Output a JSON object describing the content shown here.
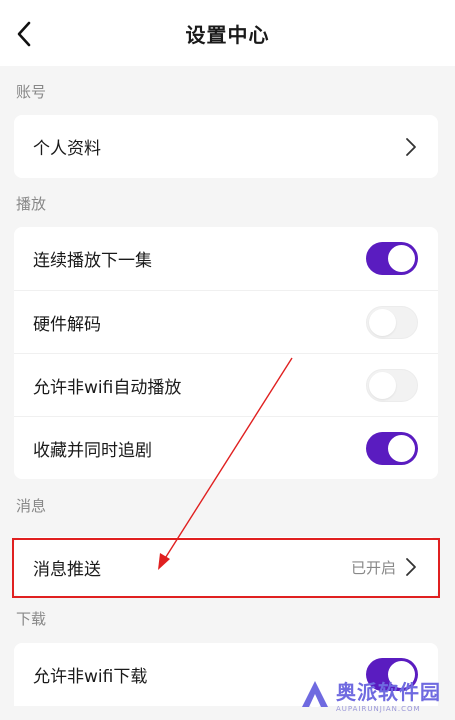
{
  "header": {
    "title": "设置中心"
  },
  "sections": {
    "account": {
      "label": "账号",
      "items": [
        {
          "label": "个人资料"
        }
      ]
    },
    "playback": {
      "label": "播放",
      "items": [
        {
          "label": "连续播放下一集",
          "toggle": "on"
        },
        {
          "label": "硬件解码",
          "toggle": "off"
        },
        {
          "label": "允许非wifi自动播放",
          "toggle": "off"
        },
        {
          "label": "收藏并同时追剧",
          "toggle": "on"
        }
      ]
    },
    "messages": {
      "label": "消息",
      "items": [
        {
          "label": "消息推送",
          "value": "已开启"
        }
      ]
    },
    "download": {
      "label": "下载",
      "items": [
        {
          "label": "允许非wifi下载",
          "toggle": "on"
        }
      ]
    }
  },
  "watermark": {
    "text": "奥派软件园",
    "sub": "AUPAIRUNJIAN.COM"
  },
  "colors": {
    "accent": "#5a1cc0",
    "highlight": "#e02020",
    "background": "#f5f5f5"
  }
}
